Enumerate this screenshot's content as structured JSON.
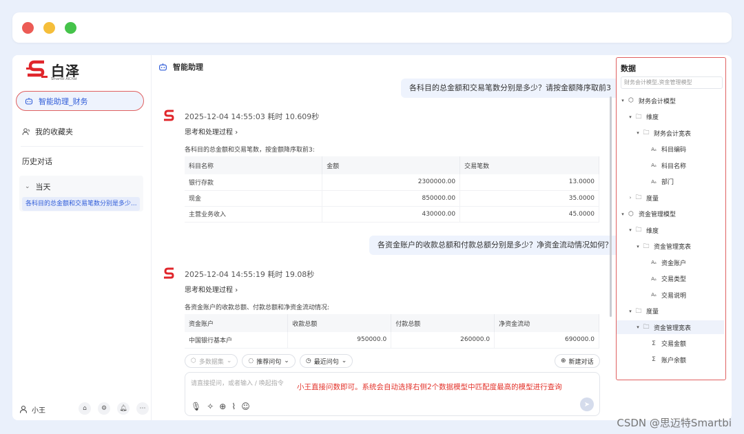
{
  "app": {
    "logo_text": "白泽",
    "logo_sub": "Smartbi AIChat"
  },
  "sidebar": {
    "active_item": "智能助理_财务",
    "favorites": "我的收藏夹",
    "history_title": "历史对话",
    "group_today": "当天",
    "history_items": [
      "各科目的总金额和交易笔数分别是多少..."
    ],
    "user_name": "小王"
  },
  "main": {
    "header": "智能助理",
    "messages": [
      {
        "question": "各科目的总金额和交易笔数分别是多少？请按金额降序取前3",
        "meta": "2025-12-04 14:55:03 耗时 10.609秒",
        "think": "思考和处理过程",
        "desc": "各科目的总金额和交易笔数，按金额降序取前3:",
        "columns": [
          "科目名称",
          "金额",
          "交易笔数"
        ],
        "rows": [
          [
            "银行存款",
            "2300000.00",
            "13.0000"
          ],
          [
            "现金",
            "850000.00",
            "35.0000"
          ],
          [
            "主营业务收入",
            "430000.00",
            "45.0000"
          ]
        ]
      },
      {
        "question": "各资金账户的收款总额和付款总额分别是多少？净资金流动情况如何？",
        "meta": "2025-12-04 14:55:19 耗时 19.08秒",
        "think": "思考和处理过程",
        "desc": "各资金账户的收款总额、付款总额和净资金流动情况:",
        "columns": [
          "资金账户",
          "收款总额",
          "付款总额",
          "净资金流动"
        ],
        "rows": [
          [
            "中国银行基本户",
            "950000.0",
            "260000.0",
            "690000.0"
          ]
        ]
      }
    ],
    "toolbar": {
      "multi_dataset": "多数据集",
      "recommend": "推荐问句",
      "recent": "最近问句",
      "new_chat": "新建对话"
    },
    "input": {
      "placeholder": "请直接提问，或者输入 / 唤起指令",
      "note": "小王直接问数即可。系统会自动选择右侧2个数据模型中匹配度最高的模型进行查询"
    }
  },
  "data_panel": {
    "title": "数据",
    "search": "财务会计模型,资金管理模型",
    "tree": [
      {
        "label": "财务会计模型",
        "level": 0,
        "icon": "cube-icon",
        "caret": "▾"
      },
      {
        "label": "维度",
        "level": 1,
        "icon": "folder-icon",
        "caret": "▾"
      },
      {
        "label": "财务会计宽表",
        "level": 2,
        "icon": "folder-icon",
        "caret": "▾"
      },
      {
        "label": "科目编码",
        "level": 3,
        "icon": "text-field-icon",
        "caret": ""
      },
      {
        "label": "科目名称",
        "level": 3,
        "icon": "text-field-icon",
        "caret": ""
      },
      {
        "label": "部门",
        "level": 3,
        "icon": "text-field-icon",
        "caret": ""
      },
      {
        "label": "度量",
        "level": 1,
        "icon": "folder-icon",
        "caret": "›"
      },
      {
        "label": "资金管理模型",
        "level": 0,
        "icon": "cube-icon",
        "caret": "▾"
      },
      {
        "label": "维度",
        "level": 1,
        "icon": "folder-icon",
        "caret": "▾"
      },
      {
        "label": "资金管理宽表",
        "level": 2,
        "icon": "folder-icon",
        "caret": "▾"
      },
      {
        "label": "资金账户",
        "level": 3,
        "icon": "text-field-icon",
        "caret": ""
      },
      {
        "label": "交易类型",
        "level": 3,
        "icon": "text-field-icon",
        "caret": ""
      },
      {
        "label": "交易说明",
        "level": 3,
        "icon": "text-field-icon",
        "caret": ""
      },
      {
        "label": "度量",
        "level": 1,
        "icon": "folder-icon",
        "caret": "▾"
      },
      {
        "label": "资金管理宽表",
        "level": 2,
        "icon": "folder-icon",
        "caret": "▾",
        "selected": true
      },
      {
        "label": "交易金额",
        "level": 3,
        "icon": "sigma-icon",
        "caret": ""
      },
      {
        "label": "账户余额",
        "level": 3,
        "icon": "sigma-icon",
        "caret": ""
      }
    ]
  },
  "watermark": "CSDN @思迈特Smartbi",
  "colors": {
    "accent": "#2f5cd8",
    "highlight_border": "#e06060",
    "note_red": "#e3332b",
    "logo_red": "#e0262b"
  }
}
